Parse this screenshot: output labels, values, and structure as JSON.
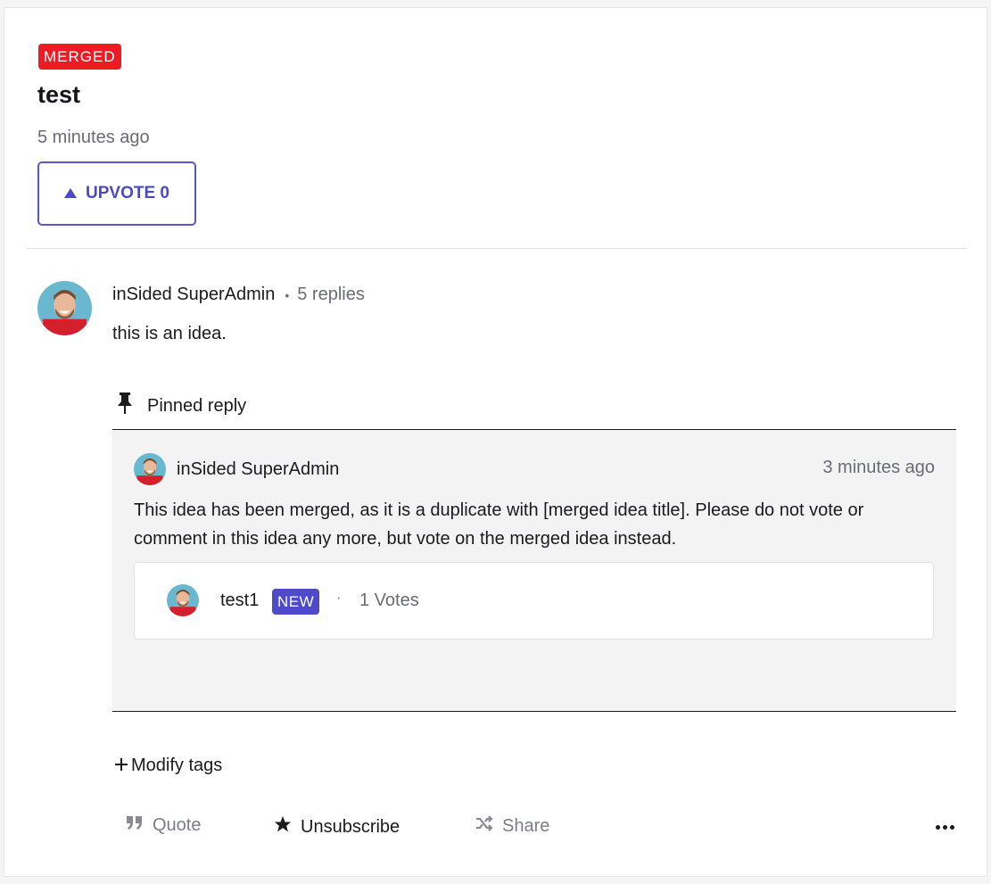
{
  "idea": {
    "status_badge": "MERGED",
    "title": "test",
    "posted_time": "5 minutes ago",
    "upvote_label": "UPVOTE 0"
  },
  "post": {
    "author": "inSided SuperAdmin",
    "separator": "•",
    "replies": "5 replies",
    "body": "this is an idea."
  },
  "pinned_reply": {
    "label": "Pinned reply",
    "author": "inSided SuperAdmin",
    "time": "3 minutes ago",
    "text": "This idea has been merged, as it is a duplicate with [merged idea title]. Please do not vote or comment in this idea any more, but vote on the merged idea instead.",
    "merged_idea": {
      "title": "test1",
      "badge": "NEW",
      "separator": "·",
      "votes": "1 Votes"
    }
  },
  "modify_tags": "Modify tags",
  "actions": {
    "quote": "Quote",
    "unsubscribe": "Unsubscribe",
    "share": "Share"
  },
  "colors": {
    "merged_badge": "#ee1b25",
    "accent": "#4c4ac2",
    "new_badge": "#4f49cb"
  }
}
